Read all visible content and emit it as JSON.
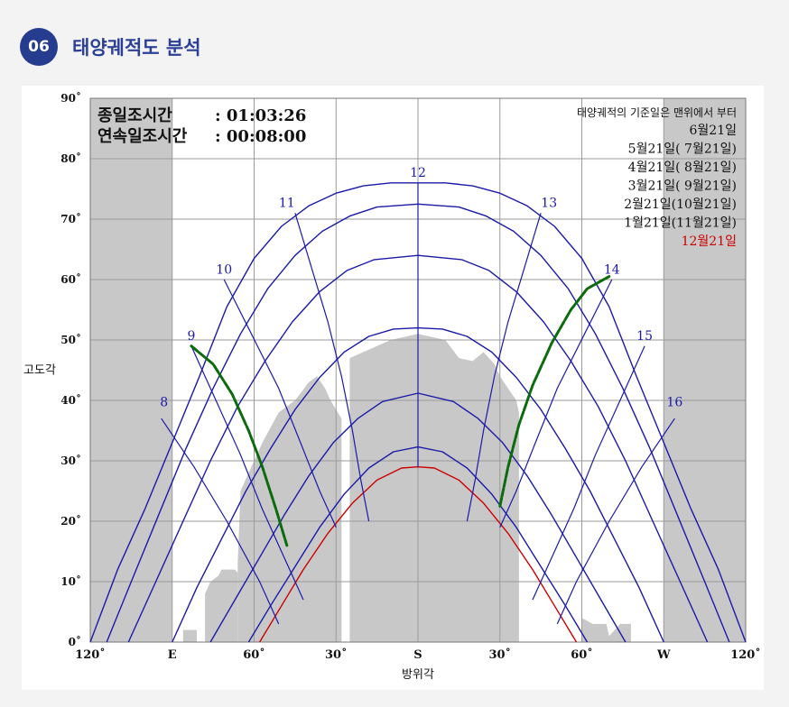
{
  "header": {
    "number": "06",
    "title": "태양궤적도 분석"
  },
  "chart_data": {
    "type": "line",
    "ylabel": "고도각",
    "xlabel": "방위각",
    "xlim": [
      -120,
      120
    ],
    "ylim": [
      0,
      90
    ],
    "x_ticks": [
      {
        "v": -120,
        "label": "120˚"
      },
      {
        "v": -90,
        "label": "E"
      },
      {
        "v": -60,
        "label": "60˚"
      },
      {
        "v": -30,
        "label": "30˚"
      },
      {
        "v": 0,
        "label": "S"
      },
      {
        "v": 30,
        "label": "30˚"
      },
      {
        "v": 60,
        "label": "60˚"
      },
      {
        "v": 90,
        "label": "W"
      },
      {
        "v": 120,
        "label": "120˚"
      }
    ],
    "y_ticks": [
      {
        "v": 0,
        "label": "0˚"
      },
      {
        "v": 10,
        "label": "10˚"
      },
      {
        "v": 20,
        "label": "20˚"
      },
      {
        "v": 30,
        "label": "30˚"
      },
      {
        "v": 40,
        "label": "40˚"
      },
      {
        "v": 50,
        "label": "50˚"
      },
      {
        "v": 60,
        "label": "60˚"
      },
      {
        "v": 70,
        "label": "70˚"
      },
      {
        "v": 80,
        "label": "80˚"
      },
      {
        "v": 90,
        "label": "90˚"
      }
    ],
    "stats": [
      {
        "label": "종일조시간",
        "value": ": 01:03:26"
      },
      {
        "label": "연속일조시간",
        "value": ": 00:08:00"
      }
    ],
    "legend": {
      "note": "태양궤적의 기준일은 맨위에서 부터",
      "items": [
        "6월21일",
        "5월21일( 7월21일)",
        "4월21일( 8월21일)",
        "3월21일( 9월21일)",
        "2월21일(10월21일)",
        "1월21일(11월21일)",
        "12월21일"
      ],
      "highlight_color": "#cc0000"
    },
    "day_paths": [
      {
        "name": "6월21일",
        "color": "#1a1aa8",
        "points": [
          [
            -120,
            0
          ],
          [
            -110,
            12
          ],
          [
            -100,
            22
          ],
          [
            -90,
            33
          ],
          [
            -80,
            44
          ],
          [
            -70,
            55.5
          ],
          [
            -60,
            63.5
          ],
          [
            -50,
            68.8
          ],
          [
            -40,
            72.2
          ],
          [
            -30,
            74.3
          ],
          [
            -20,
            75.5
          ],
          [
            -10,
            76
          ],
          [
            0,
            76
          ],
          [
            10,
            76
          ],
          [
            20,
            75.5
          ],
          [
            30,
            74.3
          ],
          [
            40,
            72.2
          ],
          [
            50,
            68.8
          ],
          [
            60,
            63.5
          ],
          [
            70,
            55.5
          ],
          [
            80,
            44
          ],
          [
            90,
            33
          ],
          [
            100,
            22
          ],
          [
            110,
            12
          ],
          [
            120,
            0
          ]
        ]
      },
      {
        "name": "5월21일( 7월21일)",
        "color": "#1a1aa8",
        "points": [
          [
            -114,
            0
          ],
          [
            -105,
            10
          ],
          [
            -95,
            21
          ],
          [
            -85,
            32
          ],
          [
            -75,
            42
          ],
          [
            -65,
            51
          ],
          [
            -55,
            58.5
          ],
          [
            -45,
            64
          ],
          [
            -35,
            68
          ],
          [
            -25,
            70.5
          ],
          [
            -15,
            72
          ],
          [
            0,
            72.5
          ],
          [
            15,
            72
          ],
          [
            25,
            70.5
          ],
          [
            35,
            68
          ],
          [
            45,
            64
          ],
          [
            55,
            58.5
          ],
          [
            65,
            51
          ],
          [
            75,
            42
          ],
          [
            85,
            32
          ],
          [
            95,
            21
          ],
          [
            105,
            10
          ],
          [
            114,
            0
          ]
        ]
      },
      {
        "name": "4월21일( 8월21일)",
        "color": "#1a1aa8",
        "points": [
          [
            -106,
            0
          ],
          [
            -96,
            10
          ],
          [
            -86,
            20
          ],
          [
            -76,
            30
          ],
          [
            -66,
            39
          ],
          [
            -56,
            46.5
          ],
          [
            -46,
            53
          ],
          [
            -36,
            58
          ],
          [
            -26,
            61.5
          ],
          [
            -16,
            63.3
          ],
          [
            0,
            64
          ],
          [
            16,
            63.3
          ],
          [
            26,
            61.5
          ],
          [
            36,
            58
          ],
          [
            46,
            53
          ],
          [
            56,
            46.5
          ],
          [
            66,
            39
          ],
          [
            76,
            30
          ],
          [
            86,
            20
          ],
          [
            96,
            10
          ],
          [
            106,
            0
          ]
        ]
      },
      {
        "name": "3월21일( 9월21일)",
        "color": "#1a1aa8",
        "points": [
          [
            -90,
            0
          ],
          [
            -81,
            9
          ],
          [
            -72,
            17
          ],
          [
            -63,
            25
          ],
          [
            -54,
            32
          ],
          [
            -45,
            38.5
          ],
          [
            -36,
            43.8
          ],
          [
            -27,
            48
          ],
          [
            -18,
            50.6
          ],
          [
            -9,
            51.8
          ],
          [
            0,
            52
          ],
          [
            9,
            51.8
          ],
          [
            18,
            50.6
          ],
          [
            27,
            48
          ],
          [
            36,
            43.8
          ],
          [
            45,
            38.5
          ],
          [
            54,
            32
          ],
          [
            63,
            25
          ],
          [
            72,
            17
          ],
          [
            81,
            9
          ],
          [
            90,
            0
          ]
        ]
      },
      {
        "name": "2월21일(10월21일)",
        "color": "#1a1aa8",
        "points": [
          [
            -76,
            0
          ],
          [
            -67,
            7
          ],
          [
            -58,
            14
          ],
          [
            -49,
            21
          ],
          [
            -40,
            27.5
          ],
          [
            -31,
            33
          ],
          [
            -22,
            37
          ],
          [
            -13,
            39.8
          ],
          [
            0,
            41.2
          ],
          [
            13,
            39.8
          ],
          [
            22,
            37
          ],
          [
            31,
            33
          ],
          [
            40,
            27.5
          ],
          [
            49,
            21
          ],
          [
            58,
            14
          ],
          [
            67,
            7
          ],
          [
            76,
            0
          ]
        ]
      },
      {
        "name": "1월21일(11월21일)",
        "color": "#1a1aa8",
        "points": [
          [
            -62,
            0
          ],
          [
            -54,
            6
          ],
          [
            -45,
            12.5
          ],
          [
            -36,
            19
          ],
          [
            -27,
            24.5
          ],
          [
            -18,
            28.8
          ],
          [
            -9,
            31.5
          ],
          [
            0,
            32.3
          ],
          [
            9,
            31.5
          ],
          [
            18,
            28.8
          ],
          [
            27,
            24.5
          ],
          [
            36,
            19
          ],
          [
            45,
            12.5
          ],
          [
            54,
            6
          ],
          [
            62,
            0
          ]
        ]
      },
      {
        "name": "12월21일",
        "color": "#cc0000",
        "points": [
          [
            -58,
            0
          ],
          [
            -50,
            6
          ],
          [
            -42,
            12
          ],
          [
            -33,
            18
          ],
          [
            -24,
            23
          ],
          [
            -15,
            26.8
          ],
          [
            -6,
            28.8
          ],
          [
            0,
            29
          ],
          [
            6,
            28.8
          ],
          [
            15,
            26.8
          ],
          [
            24,
            23
          ],
          [
            33,
            18
          ],
          [
            42,
            12
          ],
          [
            50,
            6
          ],
          [
            58,
            0
          ]
        ]
      }
    ],
    "hour_lines": [
      {
        "label": "8",
        "points": [
          [
            -94,
            37
          ],
          [
            -82,
            29
          ],
          [
            -70,
            20
          ],
          [
            -58,
            10
          ],
          [
            -51,
            3
          ]
        ]
      },
      {
        "label": "9",
        "points": [
          [
            -83,
            49
          ],
          [
            -74,
            40
          ],
          [
            -65,
            31
          ],
          [
            -57,
            22
          ],
          [
            -49,
            14
          ],
          [
            -42,
            7
          ]
        ]
      },
      {
        "label": "10",
        "points": [
          [
            -71,
            60
          ],
          [
            -61,
            51
          ],
          [
            -51,
            42
          ],
          [
            -43,
            33
          ],
          [
            -36,
            25
          ],
          [
            -30,
            19
          ]
        ]
      },
      {
        "label": "11",
        "points": [
          [
            -45,
            71
          ],
          [
            -39,
            62
          ],
          [
            -33,
            53
          ],
          [
            -28,
            44
          ],
          [
            -24,
            35
          ],
          [
            -21,
            27
          ],
          [
            -18,
            20
          ]
        ]
      },
      {
        "label": "12",
        "points": [
          [
            0,
            76
          ],
          [
            0,
            72.5
          ],
          [
            0,
            64
          ],
          [
            0,
            52
          ],
          [
            0,
            41.2
          ],
          [
            0,
            32.3
          ],
          [
            0,
            29
          ]
        ]
      },
      {
        "label": "13",
        "points": [
          [
            45,
            71
          ],
          [
            39,
            62
          ],
          [
            33,
            53
          ],
          [
            28,
            44
          ],
          [
            24,
            35
          ],
          [
            21,
            27
          ],
          [
            18,
            20
          ]
        ]
      },
      {
        "label": "14",
        "points": [
          [
            71,
            60
          ],
          [
            61,
            51
          ],
          [
            51,
            42
          ],
          [
            43,
            33
          ],
          [
            36,
            25
          ],
          [
            30,
            19
          ]
        ]
      },
      {
        "label": "15",
        "points": [
          [
            83,
            49
          ],
          [
            74,
            40
          ],
          [
            65,
            31
          ],
          [
            57,
            22
          ],
          [
            49,
            14
          ],
          [
            42,
            7
          ]
        ]
      },
      {
        "label": "16",
        "points": [
          [
            94,
            37
          ],
          [
            82,
            29
          ],
          [
            70,
            20
          ],
          [
            58,
            10
          ],
          [
            51,
            3
          ]
        ]
      }
    ],
    "hour_label_positions": [
      [
        -93,
        39
      ],
      [
        -83,
        50
      ],
      [
        -71,
        61
      ],
      [
        -48,
        72
      ],
      [
        0,
        77
      ],
      [
        48,
        72
      ],
      [
        71,
        61
      ],
      [
        83,
        50
      ],
      [
        94,
        39
      ]
    ],
    "sunshine_paths": [
      {
        "color": "#0c6b0c",
        "points": [
          [
            -83,
            49
          ],
          [
            -75,
            46
          ],
          [
            -68,
            41
          ],
          [
            -62,
            35
          ],
          [
            -57,
            29
          ],
          [
            -52,
            22
          ],
          [
            -48,
            16
          ]
        ]
      },
      {
        "color": "#0c6b0c",
        "points": [
          [
            30,
            22.5
          ],
          [
            33,
            29
          ],
          [
            37,
            36
          ],
          [
            42,
            42.5
          ],
          [
            49,
            49.5
          ],
          [
            56,
            55
          ],
          [
            62,
            58.5
          ],
          [
            70,
            60.5
          ]
        ]
      }
    ],
    "obstructions": [
      {
        "points": [
          [
            -120,
            0
          ],
          [
            -120,
            90
          ],
          [
            -90,
            90
          ],
          [
            -90,
            0
          ]
        ]
      },
      {
        "points": [
          [
            90,
            0
          ],
          [
            90,
            90
          ],
          [
            120,
            90
          ],
          [
            120,
            0
          ]
        ]
      },
      {
        "points": [
          [
            -86,
            0
          ],
          [
            -86,
            2
          ],
          [
            -81,
            2
          ],
          [
            -81,
            0
          ]
        ]
      },
      {
        "points": [
          [
            -78,
            0
          ],
          [
            -78,
            8
          ],
          [
            -76,
            10
          ],
          [
            -73,
            11
          ],
          [
            -72,
            12
          ],
          [
            -67,
            12
          ],
          [
            -66,
            11.5
          ],
          [
            -66,
            0
          ]
        ]
      },
      {
        "points": [
          [
            -66,
            0
          ],
          [
            -66,
            13
          ],
          [
            -65,
            25
          ],
          [
            -63,
            27
          ],
          [
            -60,
            30
          ],
          [
            -57,
            33
          ],
          [
            -51,
            38
          ],
          [
            -45,
            40
          ],
          [
            -40,
            43
          ],
          [
            -37,
            44
          ],
          [
            -34,
            42
          ],
          [
            -32,
            40
          ],
          [
            -28,
            37
          ],
          [
            -28,
            0
          ]
        ]
      },
      {
        "points": [
          [
            -62,
            0
          ],
          [
            -62,
            7
          ],
          [
            -60,
            7
          ],
          [
            -60,
            0
          ]
        ]
      },
      {
        "points": [
          [
            -25,
            0
          ],
          [
            -25,
            47
          ],
          [
            -20,
            48
          ],
          [
            -10,
            50
          ],
          [
            0,
            51
          ],
          [
            10,
            50
          ],
          [
            15,
            47
          ],
          [
            20,
            46.5
          ],
          [
            24,
            48
          ],
          [
            28,
            46
          ],
          [
            30,
            44
          ],
          [
            33,
            42
          ],
          [
            36,
            40
          ],
          [
            37,
            38
          ],
          [
            37,
            0
          ]
        ]
      },
      {
        "points": [
          [
            -31,
            0
          ],
          [
            -31,
            12
          ],
          [
            -29,
            12
          ],
          [
            -29,
            0
          ]
        ]
      },
      {
        "points": [
          [
            60,
            0
          ],
          [
            60,
            4
          ],
          [
            64,
            3
          ],
          [
            69,
            3
          ],
          [
            70,
            1
          ],
          [
            74,
            3
          ],
          [
            78,
            3
          ],
          [
            78,
            0
          ]
        ]
      }
    ],
    "obstruction_color": "#c8c8c8"
  }
}
